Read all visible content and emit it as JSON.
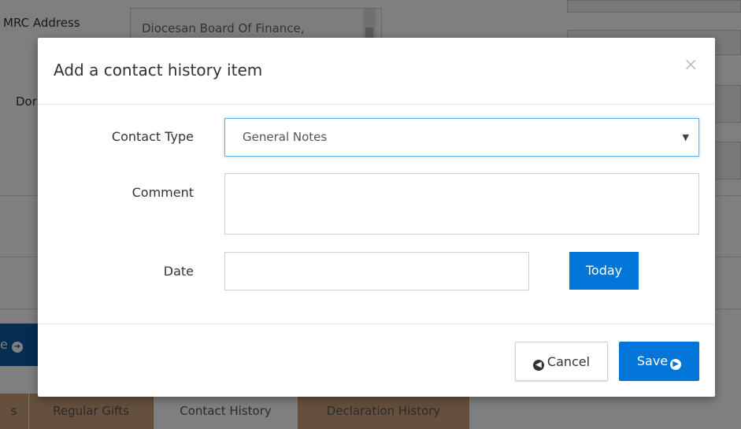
{
  "background": {
    "hmrc_address_label": "MRC Address",
    "hmrc_address_value": "Diocesan Board Of Finance,",
    "donor_label": "Dor",
    "blue_button_label": "e",
    "tabs": [
      {
        "label": "s"
      },
      {
        "label": "Regular Gifts"
      },
      {
        "label": "Contact History"
      },
      {
        "label": "Declaration History"
      }
    ]
  },
  "modal": {
    "title": "Add a contact history item",
    "close_icon": "×",
    "fields": {
      "contact_type_label": "Contact Type",
      "contact_type_value": "General Notes",
      "comment_label": "Comment",
      "comment_value": "",
      "date_label": "Date",
      "date_value": ""
    },
    "today_button": "Today",
    "cancel_button": "Cancel",
    "save_button": "Save"
  },
  "colors": {
    "primary": "#0275d8",
    "focus_border": "#66afe9",
    "tab_highlight": "#c8a179"
  }
}
